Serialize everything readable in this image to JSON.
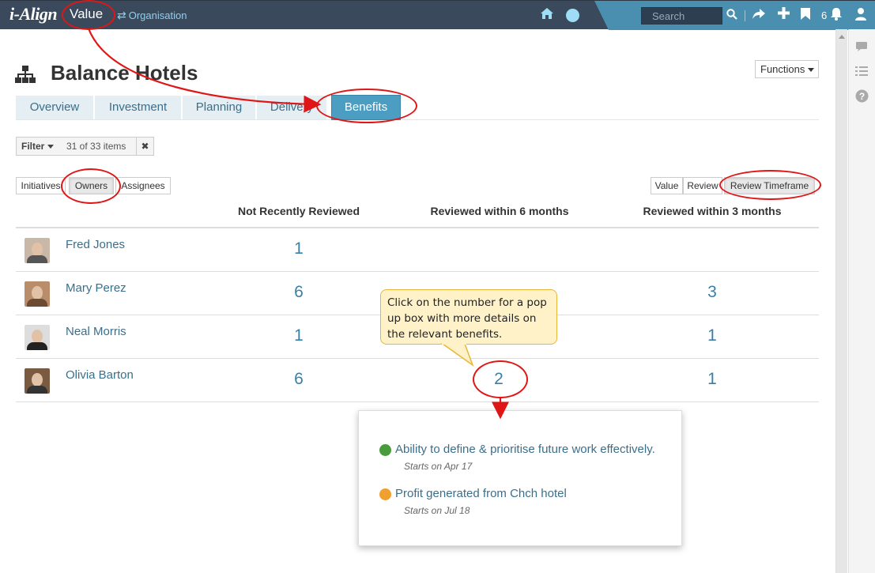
{
  "topbar": {
    "logo": "i-Align",
    "section": "Value",
    "org_link": "Organisation",
    "search_placeholder": "Search",
    "notification_count": "6"
  },
  "page": {
    "title": "Balance Hotels",
    "functions_label": "Functions"
  },
  "tabs": [
    {
      "label": "Overview",
      "active": false
    },
    {
      "label": "Investment",
      "active": false
    },
    {
      "label": "Planning",
      "active": false
    },
    {
      "label": "Delivery",
      "active": false
    },
    {
      "label": "Benefits",
      "active": true
    }
  ],
  "filter": {
    "label": "Filter",
    "count": "31 of 33 items",
    "clear": "✖"
  },
  "group_by": [
    {
      "label": "Initiatives",
      "active": false
    },
    {
      "label": "Owners",
      "active": true
    },
    {
      "label": "Assignees",
      "active": false
    }
  ],
  "view_mode": [
    {
      "label": "Value",
      "active": false
    },
    {
      "label": "Review",
      "active": false
    },
    {
      "label": "Review Timeframe",
      "active": true
    }
  ],
  "table": {
    "columns": [
      "Not Recently Reviewed",
      "Reviewed within 6 months",
      "Reviewed within 3 months"
    ],
    "rows": [
      {
        "name": "Fred Jones",
        "not_recent": "1",
        "within_6": "",
        "within_3": ""
      },
      {
        "name": "Mary Perez",
        "not_recent": "6",
        "within_6": "",
        "within_3": "3"
      },
      {
        "name": "Neal Morris",
        "not_recent": "1",
        "within_6": "",
        "within_3": "1"
      },
      {
        "name": "Olivia Barton",
        "not_recent": "6",
        "within_6": "2",
        "within_3": "1"
      }
    ]
  },
  "popup": {
    "benefits": [
      {
        "title": "Ability to define & prioritise future work effectively.",
        "starts": "Starts on Apr 17",
        "status_color": "#4a9a3e"
      },
      {
        "title": "Profit generated from Chch hotel",
        "starts": "Starts on Jul 18",
        "status_color": "#f0a030"
      }
    ]
  },
  "callout": {
    "text": "Click on the number for a pop up box with more details on the relevant benefits."
  },
  "colors": {
    "nav_dark": "#3a4a5c",
    "nav_accent": "#4a8fb0",
    "link": "#3a6f8c",
    "annotation": "#e01616"
  }
}
